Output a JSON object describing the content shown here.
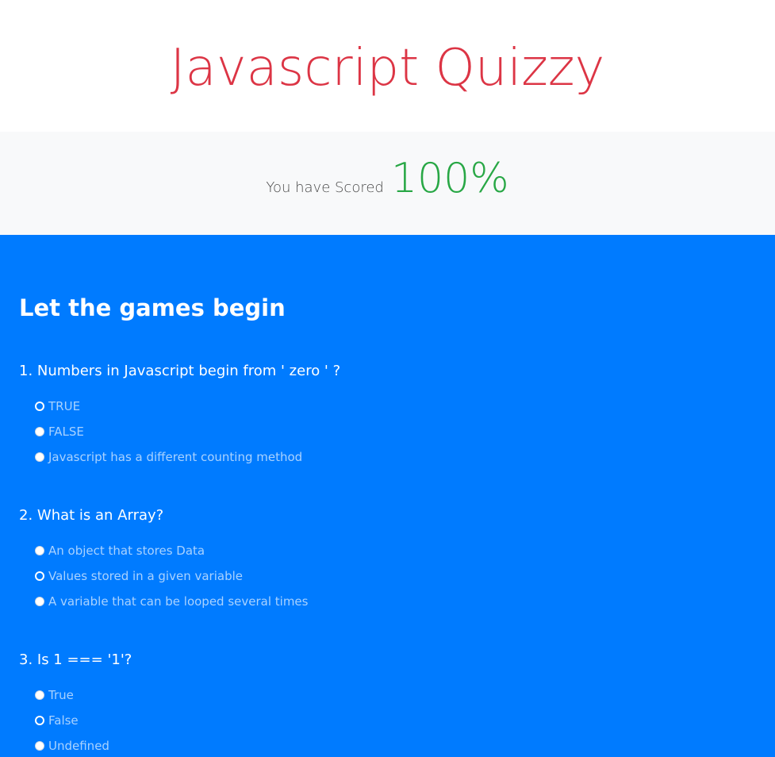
{
  "colors": {
    "title": "#dc3545",
    "score": "#28a745",
    "quiz_background": "#007bff",
    "score_background": "#f8f9fa"
  },
  "header": {
    "title": "Javascript Quizzy"
  },
  "score": {
    "label": "You have Scored",
    "value": "100%"
  },
  "quiz": {
    "heading": "Let the games begin",
    "questions": [
      {
        "text": "1. Numbers in Javascript begin from ' zero ' ?",
        "options": [
          {
            "label": "TRUE",
            "selected": true
          },
          {
            "label": "FALSE",
            "selected": false
          },
          {
            "label": "Javascript has a different counting method",
            "selected": false
          }
        ]
      },
      {
        "text": "2. What is an Array?",
        "options": [
          {
            "label": "An object that stores Data",
            "selected": false
          },
          {
            "label": "Values stored in a given variable",
            "selected": true
          },
          {
            "label": "A variable that can be looped several times",
            "selected": false
          }
        ]
      },
      {
        "text": "3. Is 1 === '1'?",
        "options": [
          {
            "label": "True",
            "selected": false
          },
          {
            "label": "False",
            "selected": true
          },
          {
            "label": "Undefined",
            "selected": false
          }
        ]
      }
    ]
  }
}
